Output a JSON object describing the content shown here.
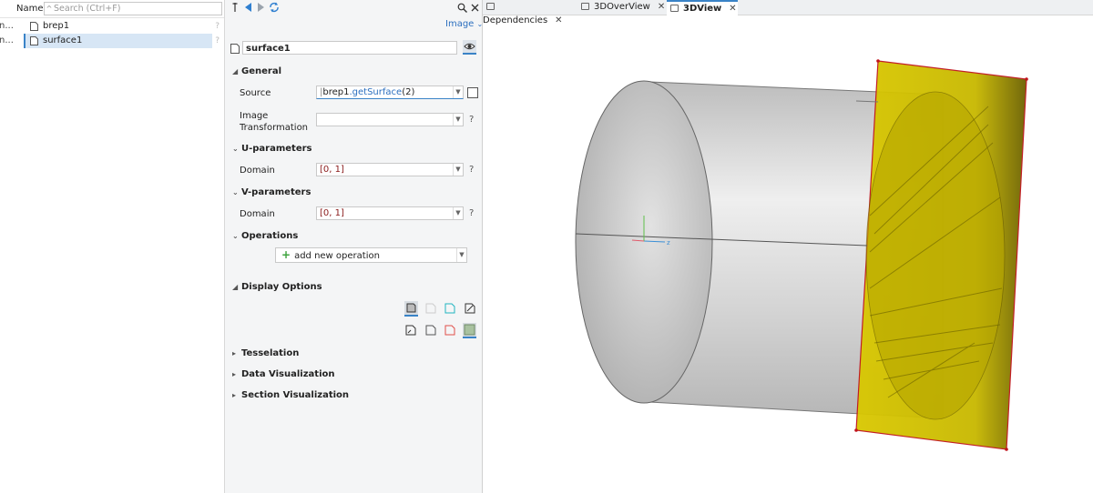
{
  "tree": {
    "column_name": "Name",
    "search_placeholder": "Search (Ctrl+F)",
    "items": [
      {
        "truncated": "n...",
        "label": "brep1",
        "help": "?"
      },
      {
        "truncated": "n...",
        "label": "surface1",
        "help": "?"
      }
    ]
  },
  "inspector": {
    "image_menu": "Image",
    "object_name": "surface1",
    "sections": {
      "general": "General",
      "u_params": "U-parameters",
      "v_params": "V-parameters",
      "operations": "Operations",
      "display_options": "Display Options",
      "tesselation": "Tesselation",
      "data_vis": "Data Visualization",
      "section_vis": "Section Visualization"
    },
    "source": {
      "label": "Source",
      "obj": "brep1",
      "fn": ".getSurface",
      "arg": "(2)"
    },
    "image_transformation": {
      "label": "Image Transformation",
      "value": "",
      "help": "?"
    },
    "u_domain": {
      "label": "Domain",
      "value": "[0, 1]",
      "help": "?"
    },
    "v_domain": {
      "label": "Domain",
      "value": "[0, 1]",
      "help": "?"
    },
    "add_operation": "add new operation"
  },
  "tabs": [
    {
      "label": "Dependencies",
      "active": false
    },
    {
      "label": "3DOverView",
      "active": false
    },
    {
      "label": "3DView",
      "active": true
    }
  ],
  "colors": {
    "accent": "#3a83c7",
    "surface_yellow": "#d4c300",
    "cylinder_gray": "#c8c8c8",
    "edge_red": "#c0141c"
  }
}
